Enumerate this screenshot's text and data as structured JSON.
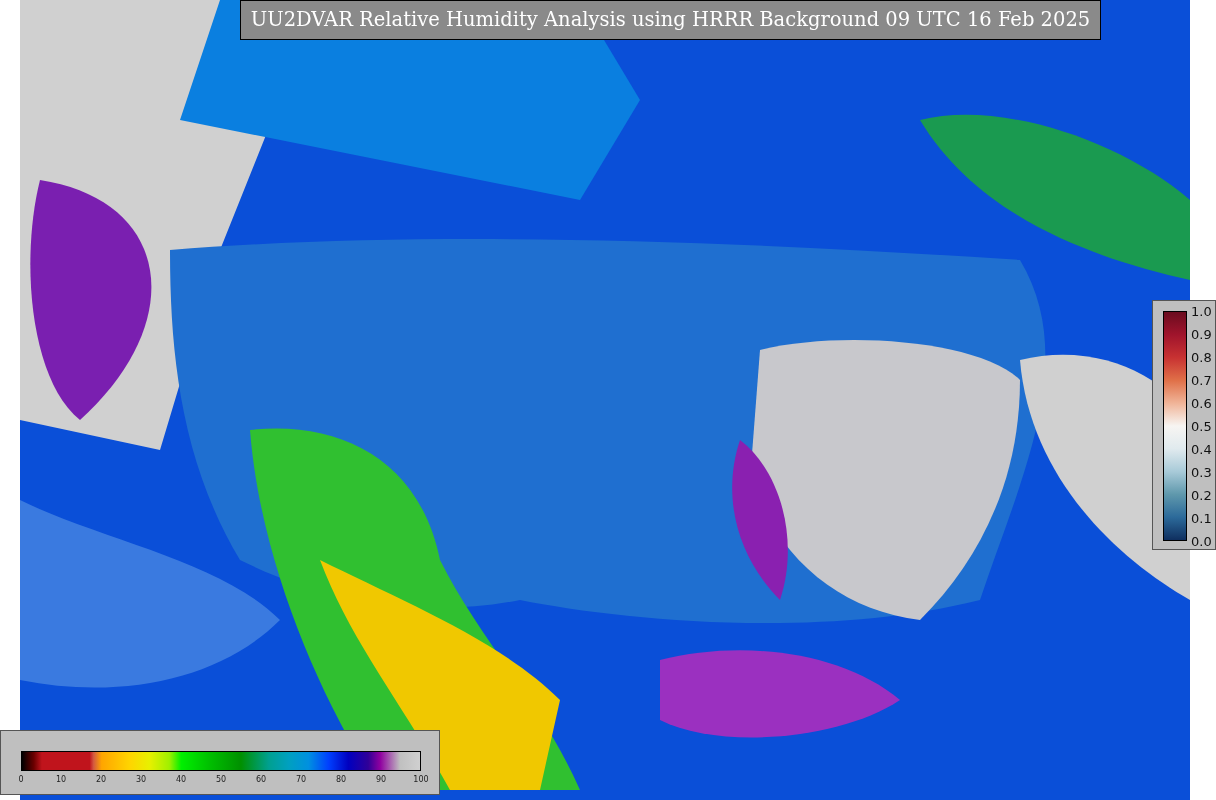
{
  "title": "UU2DVAR Relative Humidity Analysis using HRRR Background 09 UTC 16 Feb 2025",
  "humidity_colorbar": {
    "ticks": [
      "0",
      "10",
      "20",
      "30",
      "40",
      "50",
      "60",
      "70",
      "80",
      "90",
      "100"
    ]
  },
  "ratio_colorbar": {
    "ticks": [
      "1.0",
      "0.9",
      "0.8",
      "0.7",
      "0.6",
      "0.5",
      "0.4",
      "0.3",
      "0.2",
      "0.1",
      "0.0"
    ]
  }
}
